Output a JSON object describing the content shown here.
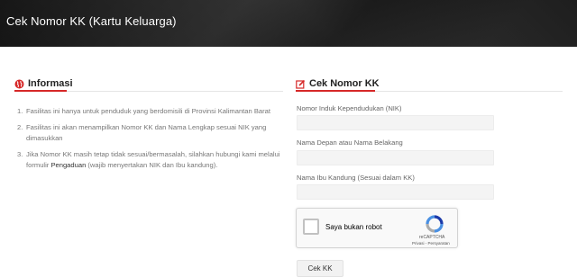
{
  "header": {
    "title": "Cek Nomor KK (Kartu Keluarga)"
  },
  "info": {
    "title": "Informasi",
    "items": [
      {
        "num": "1.",
        "text": "Fasilitas ini hanya untuk penduduk yang berdomisili di Provinsi Kalimantan Barat"
      },
      {
        "num": "2.",
        "text": "Fasilitas ini akan menampilkan Nomor KK dan Nama Lengkap sesuai NIK yang dimasukkan"
      },
      {
        "num": "3.",
        "text_before": "Jika Nomor KK masih tetap tidak sesuai/bermasalah, silahkan hubungi kami melalui formulir ",
        "link": "Pengaduan",
        "text_after": " (wajib menyertakan NIK dan Ibu kandung)."
      }
    ]
  },
  "form": {
    "title": "Cek Nomor KK",
    "nik_label": "Nomor Induk Kependudukan (NIK)",
    "nik_value": "",
    "name_label": "Nama Depan atau Nama Belakang",
    "name_value": "",
    "mother_label": "Nama Ibu Kandung (Sesuai dalam KK)",
    "mother_value": "",
    "submit_label": "Cek KK"
  },
  "recaptcha": {
    "label": "Saya bukan robot",
    "brand": "reCAPTCHA",
    "terms": "Privasi - Persyaratan"
  },
  "colors": {
    "accent": "#d62828",
    "header_bg": "#1b1b1b"
  },
  "icons": {
    "info_icon": "globe-icon",
    "form_icon": "edit-icon",
    "captcha_icon": "recaptcha-logo-icon"
  }
}
